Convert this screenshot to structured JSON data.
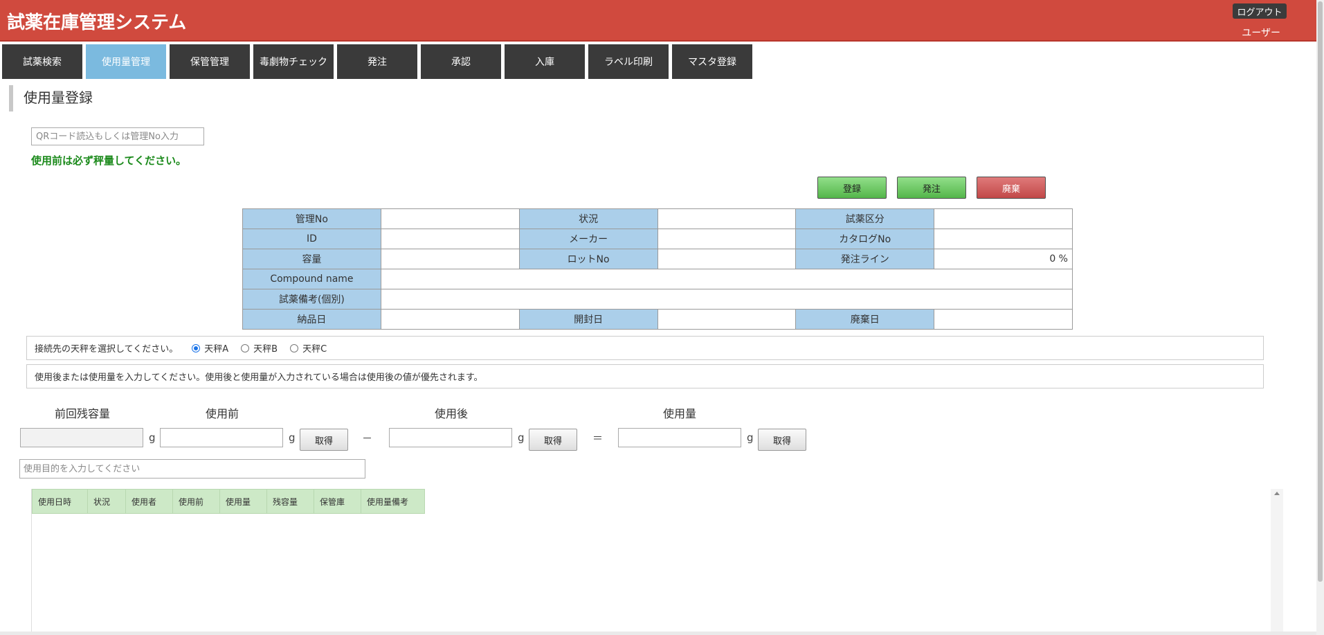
{
  "header": {
    "title": "試薬在庫管理システム",
    "logout_label": "ログアウト",
    "user_label": "ユーザー"
  },
  "nav": {
    "tabs": [
      {
        "label": "試薬検索",
        "active": false
      },
      {
        "label": "使用量管理",
        "active": true
      },
      {
        "label": "保管管理",
        "active": false
      },
      {
        "label": "毒劇物チェック",
        "active": false
      },
      {
        "label": "発注",
        "active": false
      },
      {
        "label": "承認",
        "active": false
      },
      {
        "label": "入庫",
        "active": false
      },
      {
        "label": "ラベル印刷",
        "active": false
      },
      {
        "label": "マスタ登録",
        "active": false
      }
    ]
  },
  "page": {
    "title": "使用量登録",
    "qr_placeholder": "QRコード読込もしくは管理No入力",
    "warning": "使用前は必ず秤量してください。"
  },
  "actions": {
    "register_label": "登録",
    "order_label": "発注",
    "discard_label": "廃棄"
  },
  "info": {
    "mgmt_no_label": "管理No",
    "status_label": "状況",
    "reagent_class_label": "試薬区分",
    "id_label": "ID",
    "maker_label": "メーカー",
    "catalog_no_label": "カタログNo",
    "capacity_label": "容量",
    "lot_no_label": "ロットNo",
    "order_line_label": "発注ライン",
    "order_line_value": "0 %",
    "compound_label": "Compound name",
    "remarks_label": "試薬備考(個別)",
    "delivery_label": "納品日",
    "opened_label": "開封日",
    "disposal_label": "廃棄日"
  },
  "balance": {
    "prompt": "接続先の天秤を選択してください。",
    "options": [
      {
        "label": "天秤A",
        "checked": true
      },
      {
        "label": "天秤B",
        "checked": false
      },
      {
        "label": "天秤C",
        "checked": false
      }
    ]
  },
  "notice": "使用後または使用量を入力してください。使用後と使用量が入力されている場合は使用後の値が優先されます。",
  "usage": {
    "prev_remaining_label": "前回残容量",
    "before_label": "使用前",
    "after_label": "使用後",
    "amount_label": "使用量",
    "unit": "g",
    "minus": "－",
    "equals": "＝",
    "get_label": "取得",
    "purpose_placeholder": "使用目的を入力してください"
  },
  "history": {
    "columns": [
      "使用日時",
      "状況",
      "使用者",
      "使用前",
      "使用量",
      "残容量",
      "保管庫",
      "使用量備考"
    ]
  },
  "colors": {
    "header_bg": "#d04a3e",
    "nav_bg": "#3a3a3a",
    "nav_active": "#7bbadf",
    "label_cell": "#abcfea",
    "table_header": "#cde9c7",
    "warning_text": "#1b8a1b"
  }
}
